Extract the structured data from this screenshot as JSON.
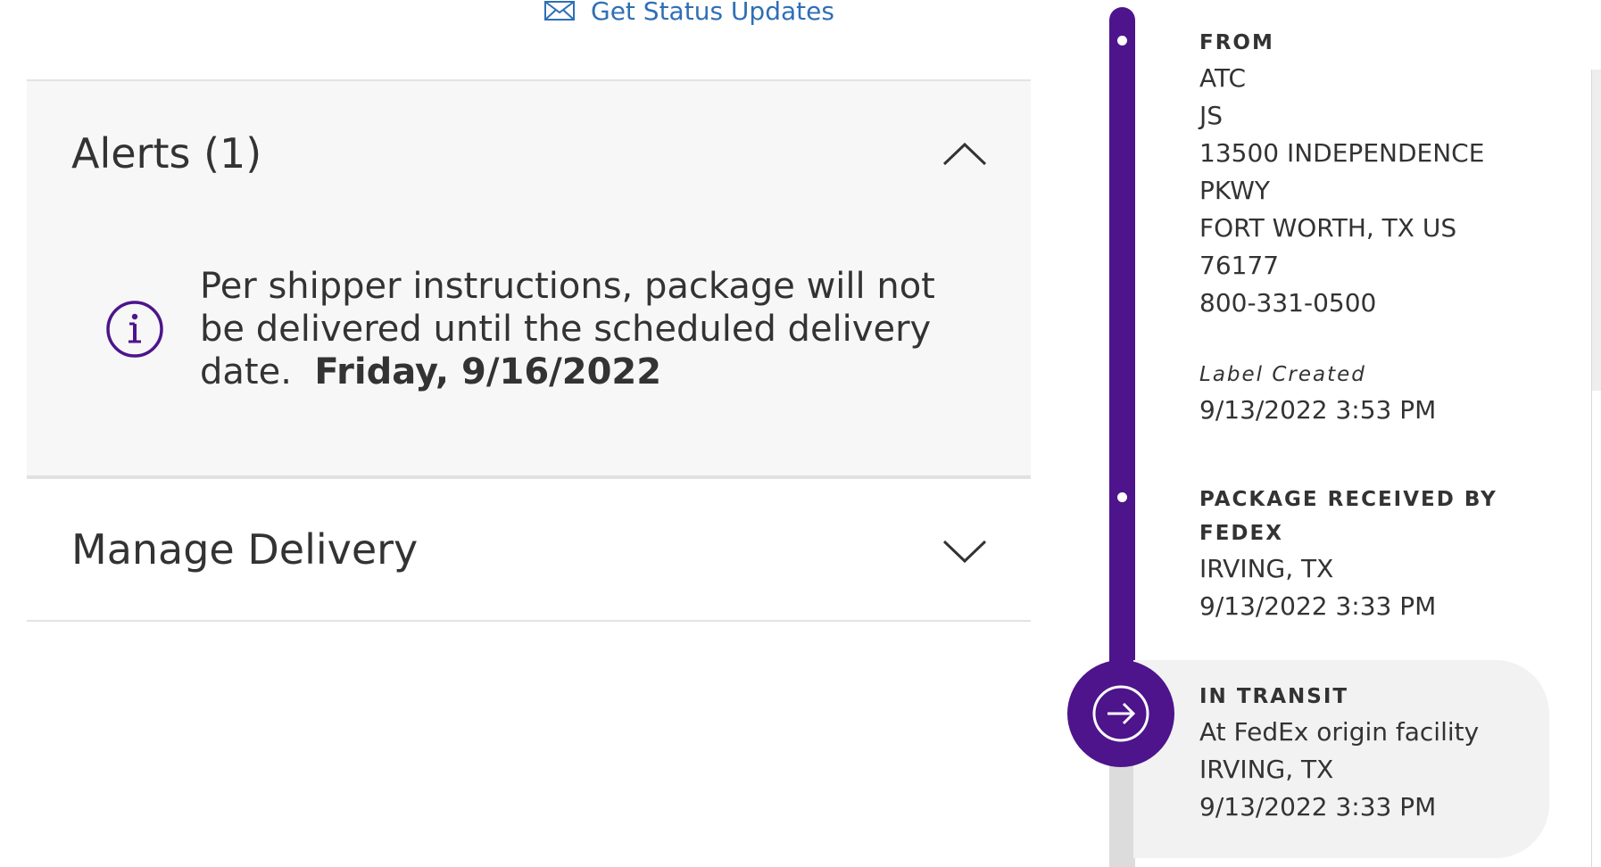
{
  "status_updates": {
    "label": "Get Status Updates",
    "icon": "mail-icon"
  },
  "alerts": {
    "title": "Alerts (1)",
    "message": "Per shipper instructions, package will not be delivered until the scheduled delivery date.",
    "date": "Friday, 9/16/2022",
    "icon": "info-icon",
    "expanded": true
  },
  "manage_delivery": {
    "title": "Manage Delivery",
    "expanded": false
  },
  "timeline": {
    "from": {
      "heading": "FROM",
      "lines": [
        "ATC",
        "JS",
        "13500 INDEPENDENCE",
        "PKWY",
        "FORT WORTH, TX US",
        "76177",
        "800-331-0500"
      ]
    },
    "label_created": {
      "heading": "Label Created",
      "timestamp": "9/13/2022 3:53 PM"
    },
    "received": {
      "heading_line1": "PACKAGE RECEIVED BY",
      "heading_line2": "FEDEX",
      "location": "IRVING, TX",
      "timestamp": "9/13/2022 3:33 PM"
    },
    "in_transit": {
      "heading": "IN TRANSIT",
      "detail": "At FedEx origin facility",
      "location": "IRVING, TX",
      "timestamp": "9/13/2022 3:33 PM",
      "icon": "arrow-right-circle-icon"
    }
  },
  "colors": {
    "brand_purple": "#4d148c",
    "link_blue": "#2f6fb5",
    "panel_grey": "#f7f7f7"
  }
}
